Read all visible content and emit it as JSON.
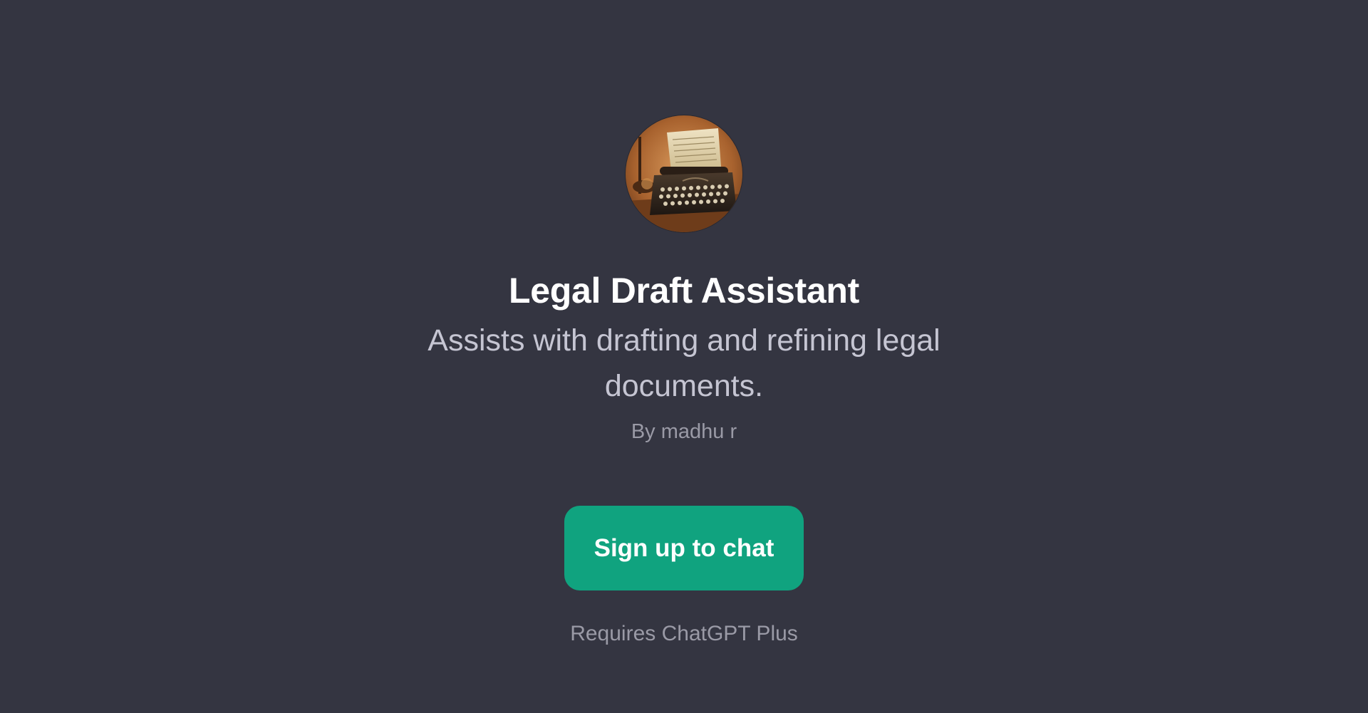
{
  "gpt": {
    "avatar_icon": "typewriter-avatar-icon",
    "title": "Legal Draft Assistant",
    "description": "Assists with drafting and refining legal documents.",
    "author": "By madhu r"
  },
  "cta": {
    "label": "Sign up to chat"
  },
  "requirement": "Requires ChatGPT Plus",
  "colors": {
    "background": "#343541",
    "accent": "#10a37f",
    "title": "#ffffff",
    "description": "#c5c5d2",
    "muted": "#9a9aa6"
  }
}
